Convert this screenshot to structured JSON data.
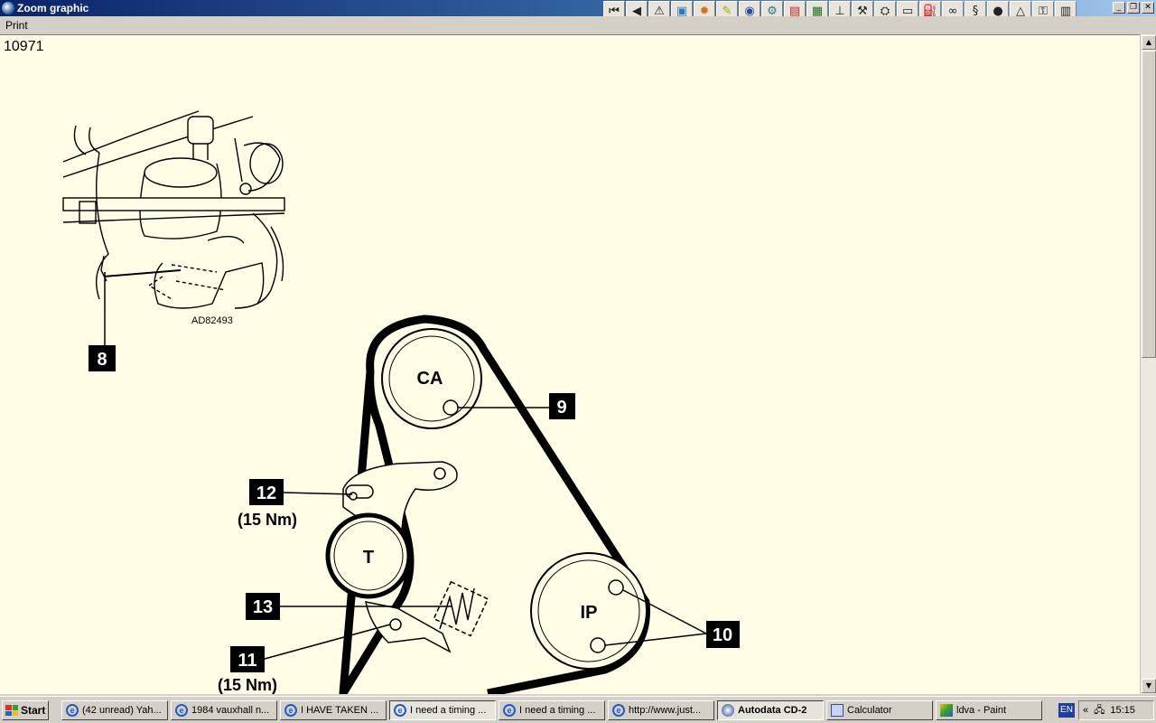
{
  "window": {
    "title": "Zoom graphic"
  },
  "menu": {
    "print": "Print"
  },
  "toolbar": {
    "icons": [
      "first-page-icon",
      "back-icon",
      "warning-icon",
      "image-icon",
      "settings-icon",
      "tools-icon",
      "gauge-icon",
      "diagnostic-icon",
      "battery-icon",
      "grid-icon",
      "lift-icon",
      "wrench-icon",
      "service-icon",
      "panel-icon",
      "engine-icon",
      "belt-icon",
      "belt-route-icon",
      "wheel-icon",
      "triangle-icon",
      "key-icon",
      "manual-icon"
    ]
  },
  "document": {
    "id": "10971",
    "figure_ref": "AD82493",
    "callouts": {
      "c8": "8",
      "c9": "9",
      "c10": "10",
      "c11": "11",
      "c12": "12",
      "c13": "13"
    },
    "torque_12": "(15 Nm)",
    "torque_11": "(15 Nm)",
    "pulley_ca": "CA",
    "pulley_t": "T",
    "pulley_ip": "IP"
  },
  "taskbar": {
    "start": "Start",
    "tasks": [
      {
        "label": "(42 unread) Yah...",
        "icon": "ie-icon"
      },
      {
        "label": "1984 vauxhall n...",
        "icon": "ie-icon"
      },
      {
        "label": "I HAVE TAKEN ...",
        "icon": "ie-icon"
      },
      {
        "label": "I need a timing ...",
        "icon": "ie-icon",
        "active": true
      },
      {
        "label": "I need a timing ...",
        "icon": "ie-icon"
      },
      {
        "label": "http://www.just...",
        "icon": "ie-icon"
      },
      {
        "label": "Autodata CD-2",
        "icon": "autodata-icon"
      },
      {
        "label": "Calculator",
        "icon": "calculator-icon"
      },
      {
        "label": "ldva - Paint",
        "icon": "paint-icon"
      }
    ],
    "language": "EN",
    "clock": "15:15"
  }
}
